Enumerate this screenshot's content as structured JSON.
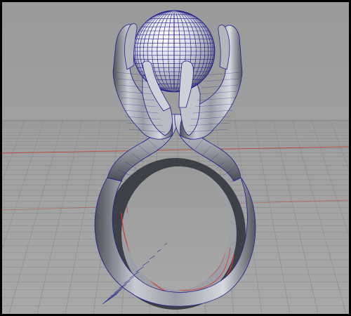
{
  "viewport": {
    "background_top": "#9a9a9a",
    "background_bottom": "#a8a8a8",
    "frame_color": "#000000"
  },
  "grid": {
    "line_color": "#8a8a8a",
    "axis_color": "#c0392b"
  },
  "model": {
    "surface_light": "#e9eaf0",
    "surface_mid": "#a5a8b3",
    "surface_dark": "#4b4d56",
    "wire_color": "#1f1f8a",
    "inner_red": "#d33a2c"
  }
}
